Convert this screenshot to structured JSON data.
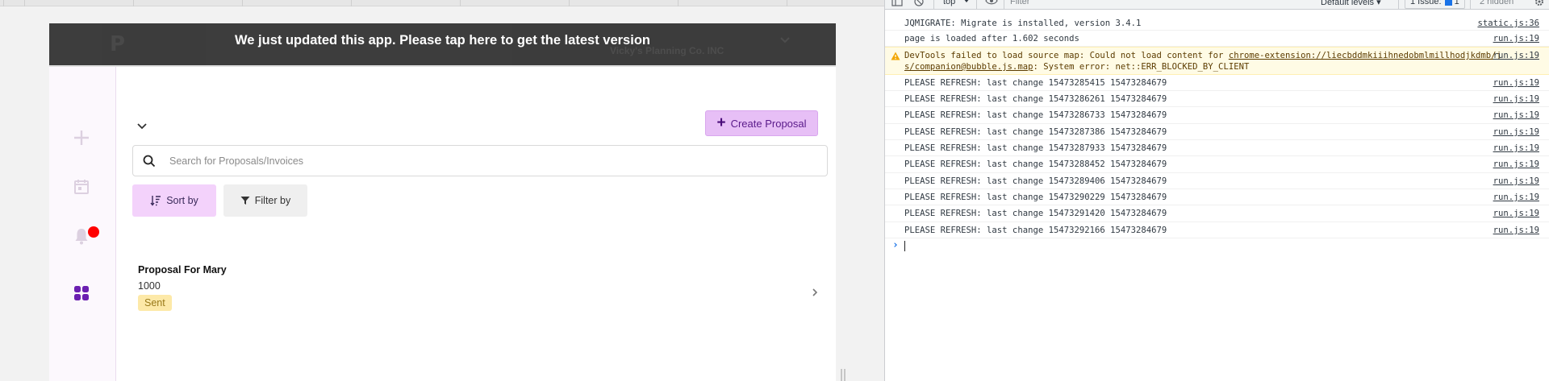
{
  "app": {
    "banner_text": "We just updated this app. Please tap here to get the latest version",
    "ghost_logo": "P",
    "ghost_company": "Vicky's Planning Co. INC"
  },
  "actions": {
    "create_label": "Create Proposal",
    "sort_label": "Sort by",
    "filter_label": "Filter by"
  },
  "search": {
    "placeholder": "Search for Proposals/Invoices",
    "value": ""
  },
  "proposals": [
    {
      "title": "Proposal For Mary",
      "amount": "1000",
      "status": "Sent"
    }
  ],
  "notifications": {
    "unread": true
  },
  "colors": {
    "accent": "#e7bff6",
    "brand_purple": "#6b1fb1",
    "badge_bg": "#fde9a8",
    "notification_dot": "#ff0000"
  },
  "devtools": {
    "toolbar": {
      "context": "top",
      "filter_placeholder": "Filter",
      "levels": "Default levels",
      "issues": "1 Issue:",
      "issues_count": "1",
      "hidden": "2 hidden"
    },
    "logs": [
      {
        "type": "log",
        "message": "JQMIGRATE: Migrate is installed, version 3.4.1",
        "source": "static.js:36"
      },
      {
        "type": "log",
        "message": "page is loaded after 1.602 seconds",
        "source": "run.js:19"
      },
      {
        "type": "warning",
        "message_prefix": "DevTools failed to load source map: Could not load content for ",
        "link_line1": "chrome-extension://liecbddmkiiihnedobmlmillhodjkdmb/j",
        "link_line2": "s/companion@bubble.js.map",
        "message_suffix": ": System error: net::ERR_BLOCKED_BY_CLIENT",
        "source": "run.js:19"
      },
      {
        "type": "log",
        "message": "PLEASE REFRESH: last change 15473285415 15473284679",
        "source": "run.js:19"
      },
      {
        "type": "log",
        "message": "PLEASE REFRESH: last change 15473286261 15473284679",
        "source": "run.js:19"
      },
      {
        "type": "log",
        "message": "PLEASE REFRESH: last change 15473286733 15473284679",
        "source": "run.js:19"
      },
      {
        "type": "log",
        "message": "PLEASE REFRESH: last change 15473287386 15473284679",
        "source": "run.js:19"
      },
      {
        "type": "log",
        "message": "PLEASE REFRESH: last change 15473287933 15473284679",
        "source": "run.js:19"
      },
      {
        "type": "log",
        "message": "PLEASE REFRESH: last change 15473288452 15473284679",
        "source": "run.js:19"
      },
      {
        "type": "log",
        "message": "PLEASE REFRESH: last change 15473289406 15473284679",
        "source": "run.js:19"
      },
      {
        "type": "log",
        "message": "PLEASE REFRESH: last change 15473290229 15473284679",
        "source": "run.js:19"
      },
      {
        "type": "log",
        "message": "PLEASE REFRESH: last change 15473291420 15473284679",
        "source": "run.js:19"
      },
      {
        "type": "log",
        "message": "PLEASE REFRESH: last change 15473292166 15473284679",
        "source": "run.js:19"
      }
    ],
    "prompt_symbol": "›"
  }
}
